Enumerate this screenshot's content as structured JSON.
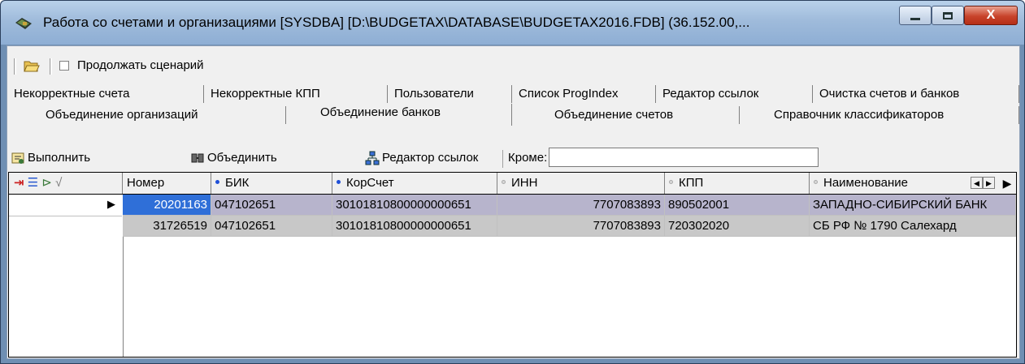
{
  "window": {
    "title": "Работа со счетами и организациями [SYSDBA] [D:\\BUDGETAX\\DATABASE\\BUDGETAX2016.FDB] (36.152.00,...",
    "close_glyph": "X"
  },
  "toolbar": {
    "continue_label": "Продолжать сценарий"
  },
  "tabs": {
    "row1": [
      "Некорректные счета",
      "Некорректные КПП",
      "Пользователи",
      "Список ProgIndex",
      "Редактор ссылок",
      "Очистка счетов и банков"
    ],
    "row2": [
      "Объединение организаций",
      "Объединение банков",
      "Объединение счетов",
      "Справочник классификаторов"
    ],
    "active": "Объединение банков"
  },
  "actions": {
    "execute_label": "Выполнить",
    "merge_label": "Объединить",
    "link_editor_label": "Редактор ссылок",
    "except_label": "Кроме:",
    "except_value": ""
  },
  "grid": {
    "columns": [
      "Номер",
      "БИК",
      "КорСчет",
      "ИНН",
      "КПП",
      "Наименование"
    ],
    "rows": [
      {
        "nomer": "20201163",
        "bik": "047102651",
        "korschet": "30101810800000000651",
        "inn": "7707083893",
        "kpp": "890502001",
        "name": "ЗАПАДНО-СИБИРСКИЙ БАНК"
      },
      {
        "nomer": "31726519",
        "bik": "047102651",
        "korschet": "30101810800000000651",
        "inn": "7707083893",
        "kpp": "720302020",
        "name": "СБ РФ № 1790 Салехард"
      }
    ]
  },
  "colors": {
    "row_selected_bg": "#2f6fd8",
    "row1_bg": "#b7b4cc",
    "row2_bg": "#c8c8c8",
    "key_dot": "#1f4fd8"
  }
}
